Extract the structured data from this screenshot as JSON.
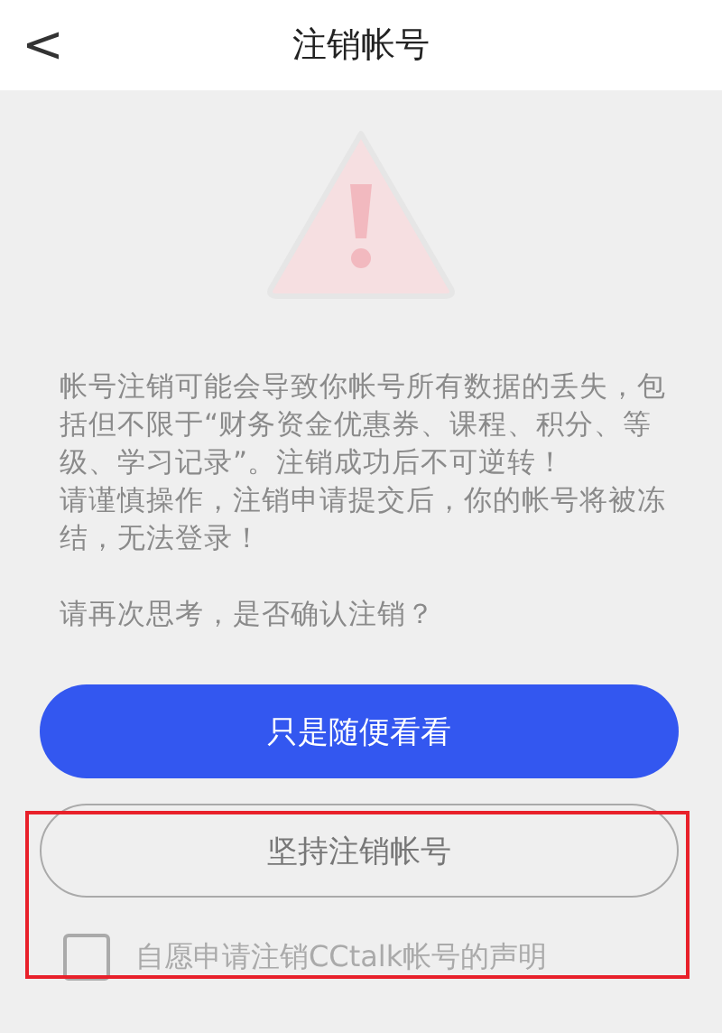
{
  "header": {
    "back": "<",
    "title": "注销帐号"
  },
  "paragraphs": [
    "帐号注销可能会导致你帐号所有数据的丢失，包括但不限于“财务资金优惠券、课程、积分、等级、学习记录”。注销成功后不可逆转！",
    "请谨慎操作，注销申请提交后，你的帐号将被冻结，无法登录！",
    "请再次思考，是否确认注销？"
  ],
  "buttons": [
    {
      "label": "只是随便看看",
      "kind": "primary"
    },
    {
      "label": "坚持注销帐号",
      "kind": "outline"
    }
  ],
  "agreement": {
    "label": "自愿申请注销CCtalk帐号的声明",
    "checked": false
  }
}
